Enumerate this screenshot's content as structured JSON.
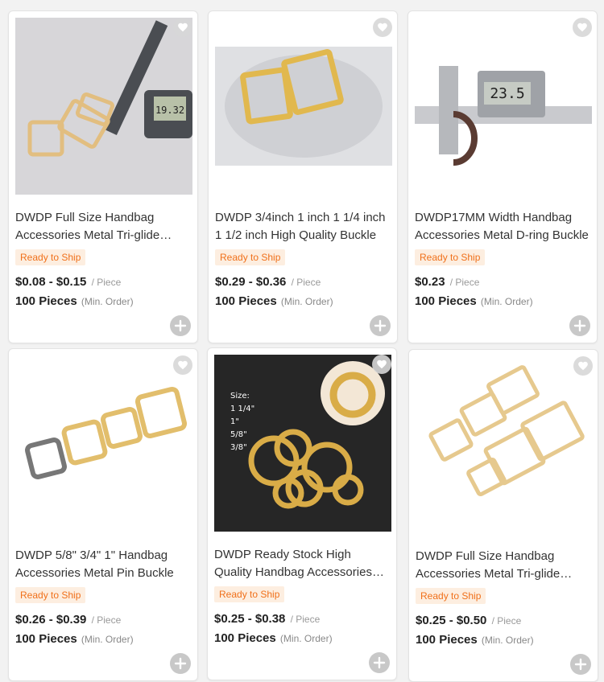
{
  "products": [
    {
      "title": "DWDP Full Size Handbag Accessories Metal Tri-glide Buckle",
      "badge": "Ready to Ship",
      "price": "$0.08 - $0.15",
      "price_unit": "/ Piece",
      "moq": "100 Pieces",
      "moq_unit": "(Min. Order)",
      "image_text": "19.32"
    },
    {
      "title": "DWDP 3/4inch 1 inch 1 1/4 inch 1 1/2 inch High Quality Buckle",
      "badge": "Ready to Ship",
      "price": "$0.29 - $0.36",
      "price_unit": "/ Piece",
      "moq": "100 Pieces",
      "moq_unit": "(Min. Order)"
    },
    {
      "title": "DWDP17MM Width Handbag Accessories Metal D-ring Buckle",
      "badge": "Ready to Ship",
      "price": "$0.23",
      "price_unit": "/ Piece",
      "moq": "100 Pieces",
      "moq_unit": "(Min. Order)",
      "image_text": "23.5"
    },
    {
      "title": "DWDP 5/8\" 3/4\" 1\" Handbag Accessories Metal Pin Buckle",
      "badge": "Ready to Ship",
      "price": "$0.26 - $0.39",
      "price_unit": "/ Piece",
      "moq": "100 Pieces",
      "moq_unit": "(Min. Order)"
    },
    {
      "title": "DWDP Ready Stock High Quality Handbag Accessories Spring Ring",
      "badge": "Ready to Ship",
      "price": "$0.25 - $0.38",
      "price_unit": "/ Piece",
      "moq": "100 Pieces",
      "moq_unit": "(Min. Order)",
      "image_text": "Size:\n1 1/4\"\n1\"\n5/8\"\n3/8\""
    },
    {
      "title": "DWDP Full Size Handbag Accessories Metal Tri-glide Buckle",
      "badge": "Ready to Ship",
      "price": "$0.25 - $0.50",
      "price_unit": "/ Piece",
      "moq": "100 Pieces",
      "moq_unit": "(Min. Order)"
    }
  ],
  "icons": {
    "favorite": "heart-icon",
    "add": "plus-icon"
  },
  "colors": {
    "badge_text": "#f0701a",
    "badge_bg": "#fdeee0",
    "gold": "#d9b45a"
  }
}
